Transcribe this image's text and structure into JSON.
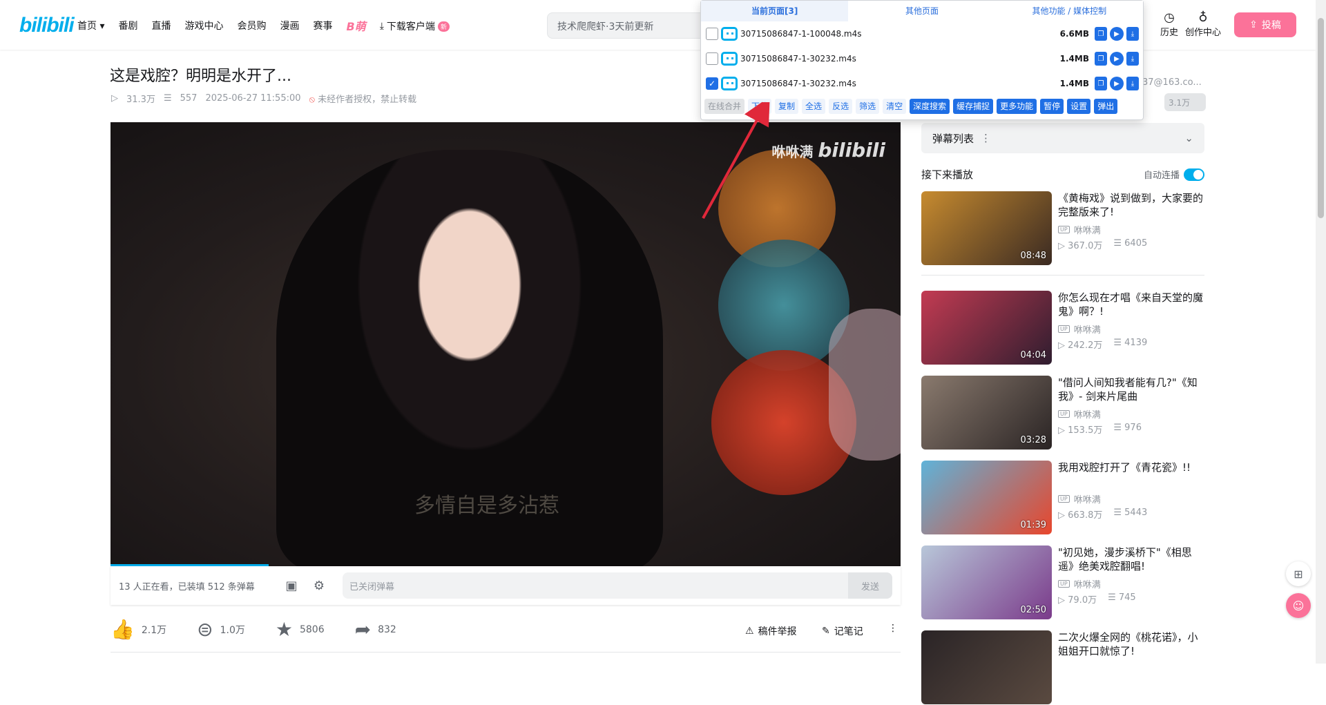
{
  "topbar": {
    "logo": "bilibili",
    "nav": [
      "首页 ▾",
      "番剧",
      "直播",
      "游戏中心",
      "会员购",
      "漫画",
      "赛事"
    ],
    "bmeng": "B萌",
    "download": "下载客户端",
    "new_badge": "新",
    "search_placeholder": "技术爬爬虾·3天前更新",
    "history": "历史",
    "creator": "创作中心",
    "upload": "投稿"
  },
  "video": {
    "title": "这是戏腔？明明是水开了...",
    "views": "31.3万",
    "danmaku_count": "557",
    "date": "2025-06-27 11:55:00",
    "notice": "未经作者授权，禁止转载",
    "watermark_name": "咻咻满",
    "watermark_logo": "bilibili",
    "subtitle": "多情自是多沾惹",
    "progress_fraction": 0.2
  },
  "danmaku_bar": {
    "info": "13 人正在看，已装填 512 条弹幕",
    "input_placeholder": "已关闭弹幕",
    "send": "发送"
  },
  "actions": {
    "like": "2.1万",
    "coin": "1.0万",
    "favorite": "5806",
    "share": "832",
    "report": "稿件举报",
    "notes": "记笔记"
  },
  "right": {
    "account_text": "37@163.co...",
    "price_text": "3.1万",
    "danmaku_list": "弹幕列表",
    "next_play": "接下来播放",
    "autoplay": "自动连播",
    "recs": [
      {
        "title": "《黄梅戏》说到做到，大家要的完整版来了!",
        "up": "咻咻满",
        "views": "367.0万",
        "dm": "6405",
        "dur": "08:48",
        "c1": "#c78b2f",
        "c2": "#3a2a22"
      },
      {
        "title": "你怎么现在才唱《来自天堂的魔鬼》啊？!",
        "up": "咻咻满",
        "views": "242.2万",
        "dm": "4139",
        "dur": "04:04",
        "c1": "#c33b52",
        "c2": "#2f1d2f"
      },
      {
        "title": "\"借问人间知我者能有几?\"《知我》- 剑来片尾曲",
        "up": "咻咻满",
        "views": "153.5万",
        "dm": "976",
        "dur": "03:28",
        "c1": "#8a7a6e",
        "c2": "#2a2424"
      },
      {
        "title": "我用戏腔打开了《青花瓷》!!",
        "up": "咻咻满",
        "views": "663.8万",
        "dm": "5443",
        "dur": "01:39",
        "c1": "#5fb3d9",
        "c2": "#e8462c"
      },
      {
        "title": "\"初见她，漫步溪桥下\"《相思遥》绝美戏腔翻唱!",
        "up": "咻咻满",
        "views": "79.0万",
        "dm": "745",
        "dur": "02:50",
        "c1": "#b8c7d9",
        "c2": "#7a3a8a"
      },
      {
        "title": "二次火爆全网的《桃花诺》，小姐姐开口就惊了!",
        "up": "",
        "views": "",
        "dm": "",
        "dur": "",
        "c1": "#2a2426",
        "c2": "#5a4a40"
      }
    ]
  },
  "overlay": {
    "tabs": [
      "当前页面[3]",
      "其他页面",
      "其他功能 / 媒体控制"
    ],
    "files": [
      {
        "name": "30715086847-1-100048.m4s",
        "size": "6.6MB",
        "checked": false
      },
      {
        "name": "30715086847-1-30232.m4s",
        "size": "1.4MB",
        "checked": false
      },
      {
        "name": "30715086847-1-30232.m4s",
        "size": "1.4MB",
        "checked": true
      }
    ],
    "buttons": [
      "在线合并",
      "下载",
      "复制",
      "全选",
      "反选",
      "筛选",
      "清空",
      "深度搜索",
      "缓存捕捉",
      "更多功能",
      "暂停",
      "设置",
      "弹出"
    ]
  },
  "colors": {
    "accent": "#00aeec",
    "pink": "#fb7299",
    "ext_blue": "#1f6fe5",
    "arrow": "#e0283a"
  }
}
